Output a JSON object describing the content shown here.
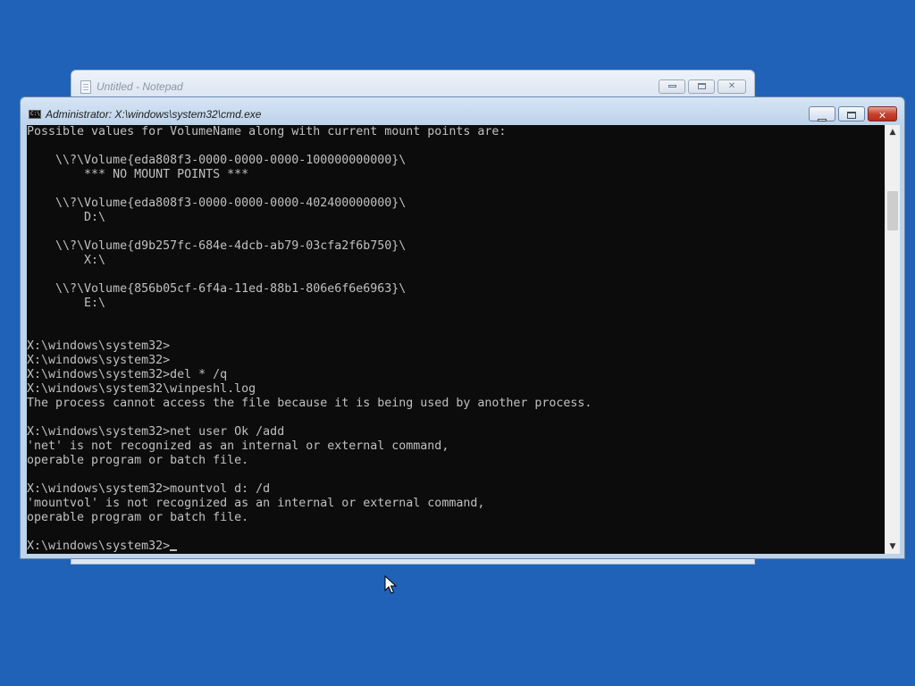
{
  "desktop": {
    "background_color": "#2062b7"
  },
  "notepad_window": {
    "title": "Untitled - Notepad",
    "icon": "notepad-icon",
    "controls": {
      "minimize": "minimize-icon",
      "maximize": "maximize-icon",
      "close": "✕"
    }
  },
  "cmd_window": {
    "title": "Administrator: X:\\windows\\system32\\cmd.exe",
    "icon_text": "C:\\",
    "controls": {
      "minimize": "minimize-icon",
      "maximize": "maximize-icon",
      "close": "✕"
    },
    "console_background": "#0c0c0c",
    "console_text_color": "#c0c0c0",
    "lines": [
      "Possible values for VolumeName along with current mount points are:",
      "",
      "    \\\\?\\Volume{eda808f3-0000-0000-0000-100000000000}\\",
      "        *** NO MOUNT POINTS ***",
      "",
      "    \\\\?\\Volume{eda808f3-0000-0000-0000-402400000000}\\",
      "        D:\\",
      "",
      "    \\\\?\\Volume{d9b257fc-684e-4dcb-ab79-03cfa2f6b750}\\",
      "        X:\\",
      "",
      "    \\\\?\\Volume{856b05cf-6f4a-11ed-88b1-806e6f6e6963}\\",
      "        E:\\",
      "",
      "",
      "X:\\windows\\system32>",
      "X:\\windows\\system32>",
      "X:\\windows\\system32>del * /q",
      "X:\\windows\\system32\\winpeshl.log",
      "The process cannot access the file because it is being used by another process.",
      "",
      "X:\\windows\\system32>net user Ok /add",
      "'net' is not recognized as an internal or external command,",
      "operable program or batch file.",
      "",
      "X:\\windows\\system32>mountvol d: /d",
      "'mountvol' is not recognized as an internal or external command,",
      "operable program or batch file.",
      "",
      "X:\\windows\\system32>"
    ]
  }
}
